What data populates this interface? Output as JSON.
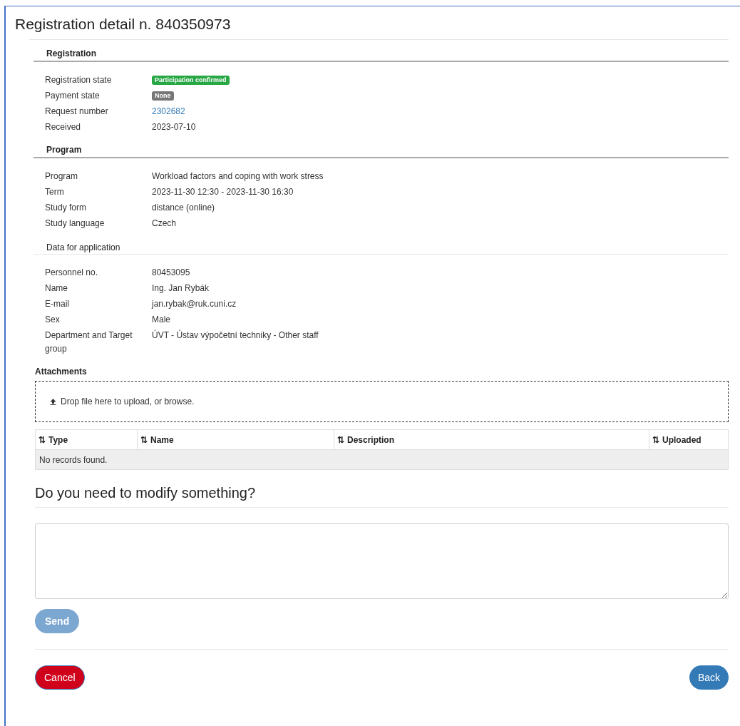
{
  "title": "Registration detail n. 840350973",
  "sections": [
    {
      "heading": "Registration",
      "kind": "strong",
      "rows": [
        {
          "label": "Registration state",
          "kind": "badge",
          "value": "Participation confirmed",
          "color": "#28a745"
        },
        {
          "label": "Payment state",
          "kind": "badge",
          "value": "None",
          "color": "#777777"
        },
        {
          "label": "Request number",
          "kind": "link",
          "value": "2302682"
        },
        {
          "label": "Received",
          "kind": "text",
          "value": "2023-07-10"
        }
      ]
    },
    {
      "heading": "Program",
      "kind": "strong",
      "rows": [
        {
          "label": "Program",
          "kind": "text",
          "value": "Workload factors and coping with work stress"
        },
        {
          "label": "Term",
          "kind": "text",
          "value": "2023-11-30 12:30 - 2023-11-30 16:30"
        },
        {
          "label": "Study form",
          "kind": "text",
          "value": "distance (online)"
        },
        {
          "label": "Study language",
          "kind": "text",
          "value": "Czech"
        }
      ]
    },
    {
      "heading": "Data for application",
      "kind": "plain",
      "rows": [
        {
          "label": "Personnel no.",
          "kind": "text",
          "value": "80453095"
        },
        {
          "label": "Name",
          "kind": "text",
          "value": "Ing. Jan Rybák"
        },
        {
          "label": "E-mail",
          "kind": "text",
          "value": "jan.rybak@ruk.cuni.cz"
        },
        {
          "label": "Sex",
          "kind": "text",
          "value": "Male"
        },
        {
          "label": "Department and Target group",
          "kind": "text",
          "value": "ÚVT - Ústav výpočetní techniky - Other staff"
        }
      ]
    }
  ],
  "attachments": {
    "heading": "Attachments",
    "dropzone": "Drop file here to upload, or browse.",
    "columns": [
      {
        "label": "Type",
        "sort_icon": "⇅"
      },
      {
        "label": "Name",
        "sort_icon": "⇅"
      },
      {
        "label": "Description",
        "sort_icon": "⇅"
      },
      {
        "label": "Uploaded",
        "sort_icon": "⇅"
      }
    ],
    "empty_message": "No records found."
  },
  "modify": {
    "heading": "Do you need to modify something?",
    "send": {
      "label": "Send",
      "disabled": true
    }
  },
  "footer": {
    "cancel": "Cancel",
    "back": "Back"
  }
}
